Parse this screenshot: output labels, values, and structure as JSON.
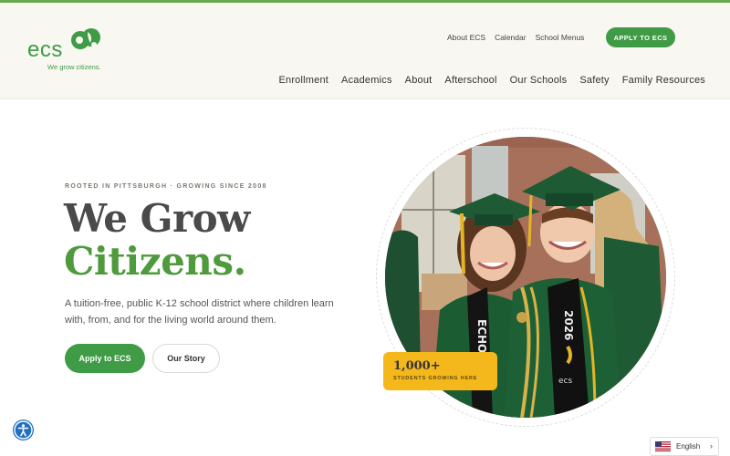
{
  "brand": {
    "logo_text": "ecs",
    "tagline": "We grow citizens."
  },
  "utility_nav": {
    "items": [
      "About ECS",
      "Calendar",
      "School Menus"
    ],
    "apply_label": "APPLY TO ECS"
  },
  "main_nav": {
    "items": [
      "Enrollment",
      "Academics",
      "About",
      "Afterschool",
      "Our Schools",
      "Safety",
      "Family Resources"
    ]
  },
  "hero": {
    "eyebrow": "ROOTED IN PITTSBURGH · GROWING SINCE 2008",
    "title_line1": "We Grow",
    "title_line2": "Citizens.",
    "description": "A tuition-free, public K-12 school district where children learn with, from, and for the living world around them.",
    "primary_cta": "Apply to ECS",
    "secondary_cta": "Our Story"
  },
  "stat": {
    "number": "1,000+",
    "label": "STUDENTS GROWING HERE"
  },
  "photo": {
    "stole_left": "ECHO",
    "stole_right": "2026",
    "stole_logo": "ecs"
  },
  "language": {
    "selected": "English"
  },
  "colors": {
    "brand_green": "#3f9b45",
    "title_green": "#4f9a3c",
    "accent_yellow": "#f5b81c",
    "header_bg": "#f8f7f1"
  }
}
